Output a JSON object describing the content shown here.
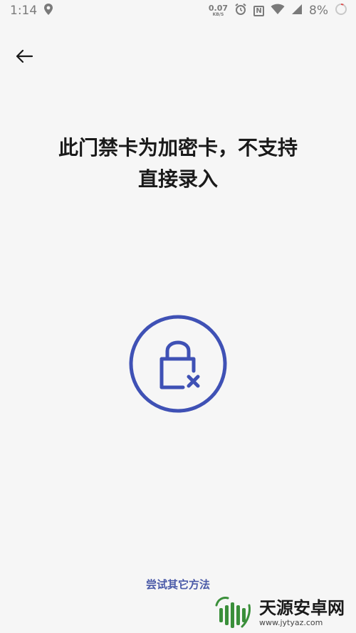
{
  "status_bar": {
    "time": "1:14",
    "net_speed_value": "0.07",
    "net_speed_unit": "KB/S",
    "nfc_label": "N",
    "battery_text": "8%"
  },
  "header": {
    "back_icon": "arrow-left-icon"
  },
  "main": {
    "message_line1": "此门禁卡为加密卡，不支持",
    "message_line2": "直接录入",
    "lock_icon": "lock-x-icon",
    "alt_action_label": "尝试其它方法"
  },
  "watermark": {
    "name": "天源安卓网",
    "url": "www.jytyaz.com"
  },
  "colors": {
    "accent": "#3f51b5",
    "link": "#4a5aa8",
    "background": "#f6f6f6",
    "status_gray": "#7a7a7a"
  }
}
